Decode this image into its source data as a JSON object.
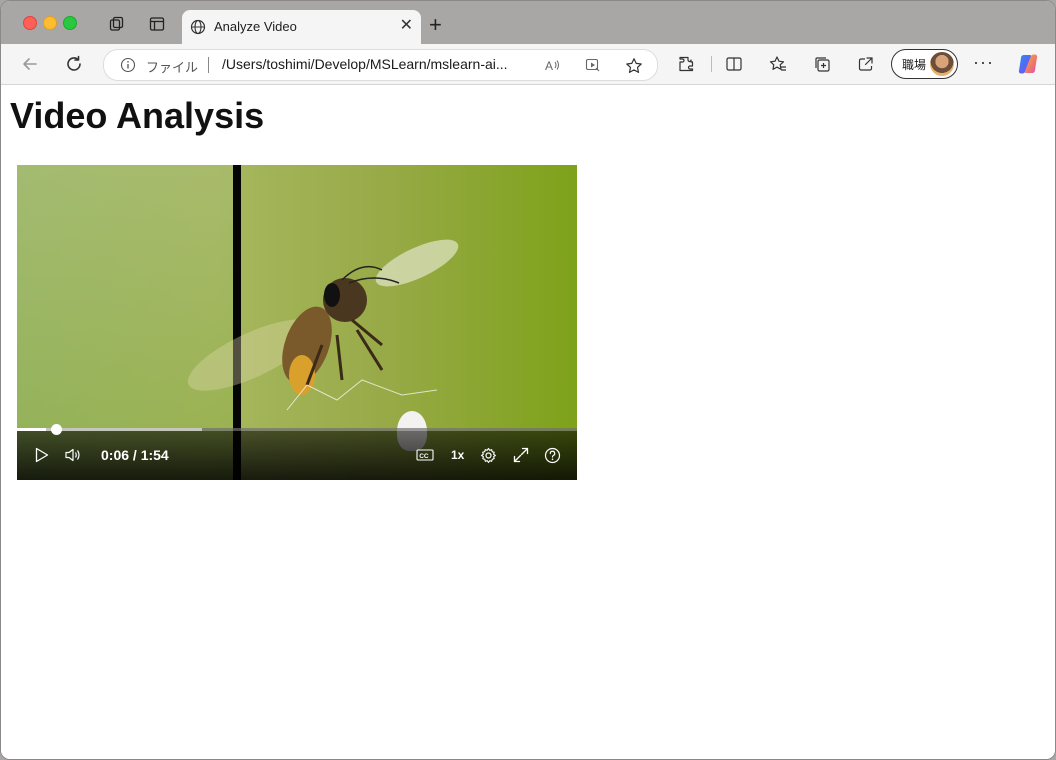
{
  "browser": {
    "tab": {
      "title": "Analyze Video"
    },
    "address": {
      "scheme_label": "ファイル",
      "url": "/Users/toshimi/Develop/MSLearn/mslearn-ai..."
    },
    "profile": {
      "name": "職場"
    }
  },
  "page": {
    "heading": "Video Analysis",
    "video": {
      "time_display": "0:06 / 1:54",
      "speed_label": "1x",
      "progress_played_fraction": 0.052,
      "progress_buffered_fraction": 0.33
    }
  },
  "colors": {
    "tabbar_bg": "#a9a6a6",
    "toolbar_bg": "#f6f5f5",
    "traffic_red": "#fe5f57",
    "traffic_yellow": "#febc2e",
    "traffic_green": "#28c840"
  },
  "icons": [
    "workspaces-icon",
    "tab-actions-icon",
    "globe-icon",
    "close-icon",
    "new-tab-icon",
    "back-icon",
    "reload-icon",
    "info-icon",
    "read-aloud-icon",
    "media-icon",
    "favorite-icon",
    "extensions-icon",
    "split-screen-icon",
    "favorites-icon",
    "collections-icon",
    "share-icon",
    "more-icon",
    "copilot-icon",
    "play-icon",
    "volume-icon",
    "captions-icon",
    "settings-icon",
    "fullscreen-icon",
    "help-icon"
  ]
}
